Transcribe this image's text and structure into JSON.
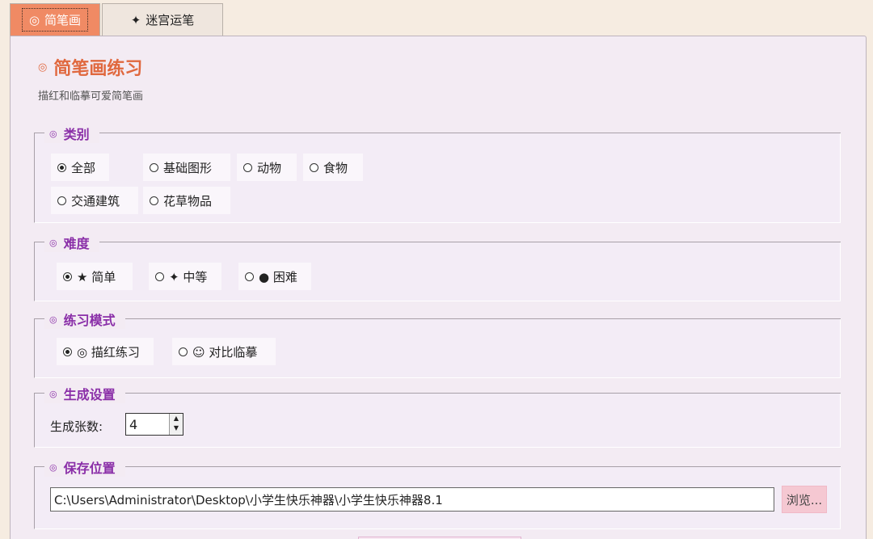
{
  "tabs": [
    {
      "icon": "◎",
      "label": "简笔画",
      "active": true
    },
    {
      "icon": "✦",
      "label": "迷宫运笔",
      "active": false
    }
  ],
  "header": {
    "icon": "◎",
    "title": "简笔画练习",
    "subtitle": "描红和临摹可爱简笔画"
  },
  "category": {
    "legend": "类别",
    "bullet": "◎",
    "options": [
      "全部",
      "基础图形",
      "动物",
      "食物",
      "交通建筑",
      "花草物品"
    ],
    "selected": "全部"
  },
  "difficulty": {
    "legend": "难度",
    "bullet": "◎",
    "options": [
      "★ 简单",
      "✦ 中等",
      "● 困难"
    ],
    "selected": "★ 简单"
  },
  "mode": {
    "legend": "练习模式",
    "bullet": "◎",
    "options": [
      "◎ 描红练习",
      "☺ 对比临摹"
    ],
    "selected": "◎ 描红练习"
  },
  "generate": {
    "legend": "生成设置",
    "bullet": "◎",
    "count_label": "生成张数:",
    "count_value": "4",
    "up_arrow": "▲",
    "down_arrow": "▼"
  },
  "save": {
    "legend": "保存位置",
    "bullet": "◎",
    "path": "C:\\Users\\Administrator\\Desktop\\小学生快乐神器\\小学生快乐神器8.1",
    "browse_label": "浏览..."
  }
}
